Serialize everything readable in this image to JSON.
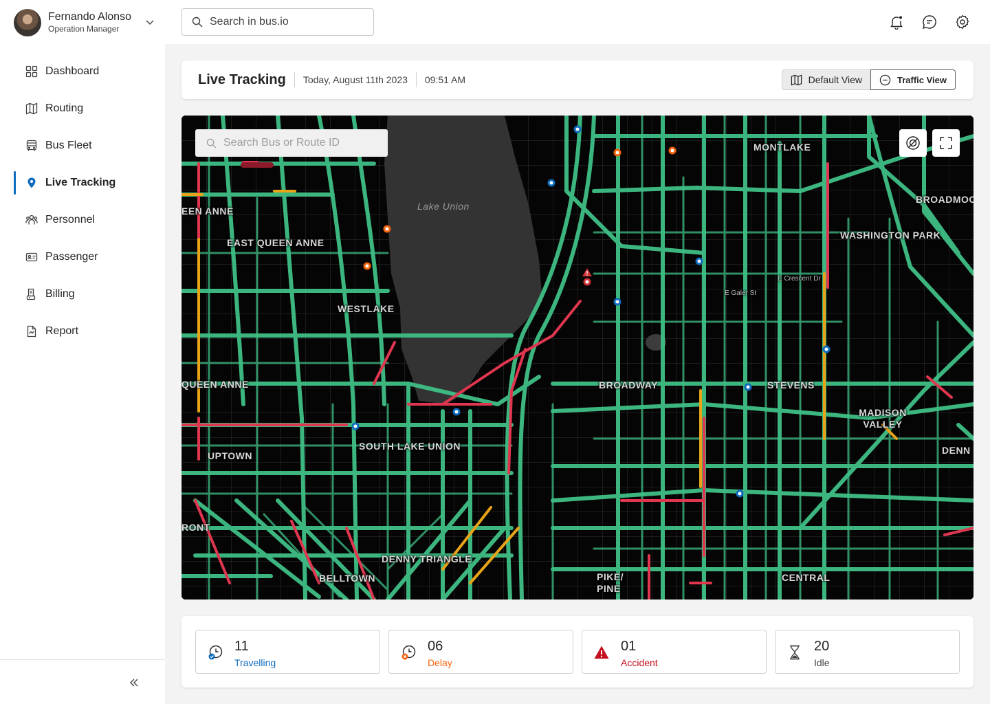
{
  "user": {
    "name": "Fernando Alonso",
    "role": "Operation Manager"
  },
  "topbar": {
    "search_placeholder": "Search in bus.io",
    "icons": [
      "bell-icon",
      "chat-icon",
      "gear-icon"
    ]
  },
  "sidebar": {
    "items": [
      {
        "label": "Dashboard",
        "icon": "grid-icon",
        "active": false
      },
      {
        "label": "Routing",
        "icon": "map-icon",
        "active": false
      },
      {
        "label": "Bus Fleet",
        "icon": "bus-icon",
        "active": false
      },
      {
        "label": "Live Tracking",
        "icon": "location-pin-icon",
        "active": true
      },
      {
        "label": "Personnel",
        "icon": "people-icon",
        "active": false
      },
      {
        "label": "Passenger",
        "icon": "id-card-icon",
        "active": false
      },
      {
        "label": "Billing",
        "icon": "receipt-icon",
        "active": false
      },
      {
        "label": "Report",
        "icon": "document-icon",
        "active": false
      }
    ]
  },
  "header": {
    "title": "Live Tracking",
    "date": "Today, August 11th 2023",
    "time": "09:51 AM",
    "views": {
      "default_label": "Default View",
      "traffic_label": "Traffic View",
      "selected": "Traffic View"
    }
  },
  "map": {
    "search_placeholder": "Search Bus or Route ID",
    "areas": {
      "montlake": "MONTLAKE",
      "broadmoor": "BROADMOO",
      "queen_anne_top": "EEN ANNE",
      "east_queen_anne": "EAST QUEEN ANNE",
      "washington_park": "WASHINGTON PARK",
      "westlake": "WESTLAKE",
      "queen_anne": "QUEEN ANNE",
      "broadway": "BROADWAY",
      "stevens": "STEVENS",
      "madison_valley": "MADISON VALLEY",
      "south_lake_union": "SOUTH LAKE UNION",
      "uptown": "UPTOWN",
      "denny": "DENN",
      "front": "RONT",
      "denny_triangle": "DENNY TRIANGLE",
      "belltown": "BELLTOWN",
      "pike_pine": "PIKE/ PINE",
      "central": "CENTRAL"
    },
    "water": "Lake Union",
    "streets": {
      "crescent": "E Crescent Dr",
      "galer": "E Galer St"
    },
    "colors": {
      "flow": "#3fbf86",
      "slow": "#e8a317",
      "jam": "#e0364f",
      "bus": "#0f6cbd",
      "delay": "#f7630c",
      "accident": "#d13438"
    }
  },
  "stats": [
    {
      "value": "11",
      "label": "Travelling",
      "color": "#0f6cbd",
      "icon": "clock-check-icon"
    },
    {
      "value": "06",
      "label": "Delay",
      "color": "#f7630c",
      "icon": "clock-delay-icon"
    },
    {
      "value": "01",
      "label": "Accident",
      "color": "#c50f1f",
      "icon": "warning-icon"
    },
    {
      "value": "20",
      "label": "Idle",
      "color": "#424242",
      "icon": "hourglass-icon"
    }
  ]
}
